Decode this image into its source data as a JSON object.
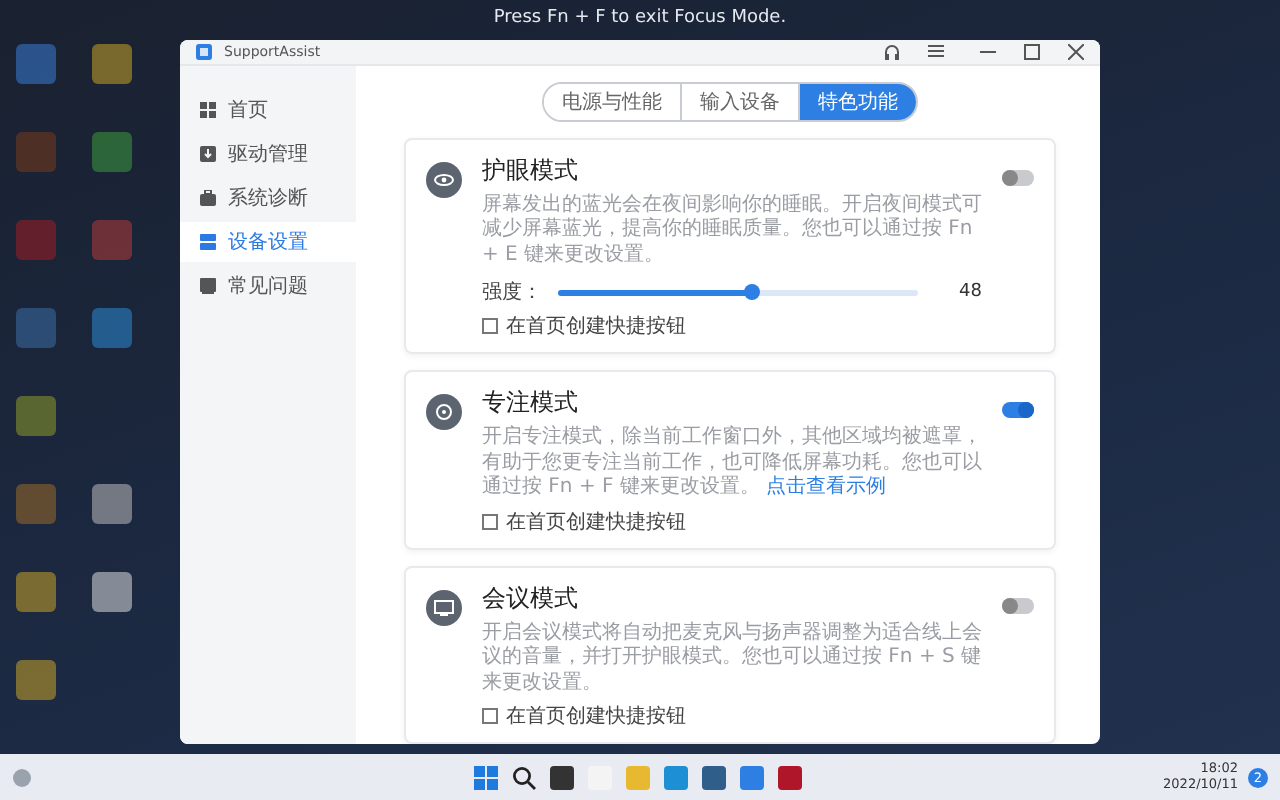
{
  "focus_hint": "Press Fn + F to exit Focus Mode.",
  "window": {
    "title": "SupportAssist"
  },
  "sidebar": {
    "items": [
      {
        "label": "首页",
        "selected": false,
        "kind": "grid"
      },
      {
        "label": "驱动管理",
        "selected": false,
        "kind": "driver"
      },
      {
        "label": "系统诊断",
        "selected": false,
        "kind": "kit"
      },
      {
        "label": "设备设置",
        "selected": true,
        "kind": "device"
      },
      {
        "label": "常见问题",
        "selected": false,
        "kind": "book"
      }
    ]
  },
  "tabs": [
    {
      "label": "电源与性能",
      "selected": false
    },
    {
      "label": "输入设备",
      "selected": false
    },
    {
      "label": "特色功能",
      "selected": true
    }
  ],
  "cards": [
    {
      "kind": "eye",
      "title": "护眼模式",
      "description": "屏幕发出的蓝光会在夜间影响你的睡眠。开启夜间模式可减少屏幕蓝光，提高你的睡眠质量。您也可以通过按 Fn + E 键来更改设置。",
      "on": false,
      "slider": {
        "label": "强度：",
        "level": 0.54,
        "reading": "48"
      },
      "shortcut": {
        "label": "在首页创建快捷按钮",
        "checked": false
      }
    },
    {
      "kind": "focus",
      "title": "专注模式",
      "description": "开启专注模式，除当前工作窗口外，其他区域均被遮罩，有助于您更专注当前工作，也可降低屏幕功耗。您也可以通过按 Fn + F 键来更改设置。",
      "link": "点击查看示例",
      "on": true,
      "shortcut": {
        "label": "在首页创建快捷按钮",
        "checked": false
      }
    },
    {
      "kind": "meeting",
      "title": "会议模式",
      "description": "开启会议模式将自动把麦克风与扬声器调整为适合线上会议的音量，并打开护眼模式。您也可以通过按 Fn + S 键来更改设置。",
      "on": false,
      "shortcut": {
        "label": "在首页创建快捷按钮",
        "checked": false
      }
    }
  ],
  "taskbar": {
    "time": "18:02",
    "date": "2022/10/11",
    "notifications": "2"
  }
}
